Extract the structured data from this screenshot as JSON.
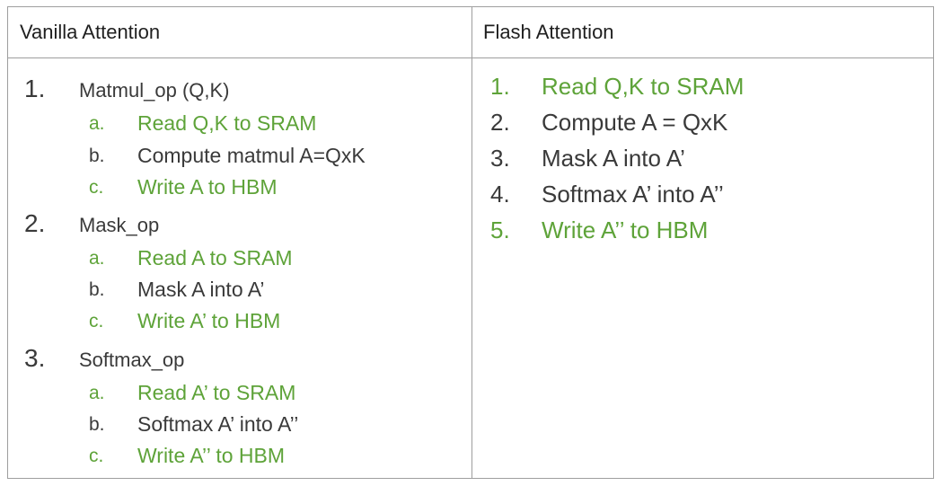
{
  "table": {
    "headers": {
      "left": "Vanilla Attention",
      "right": "Flash Attention"
    },
    "vanilla": [
      {
        "number": "1.",
        "label": "Matmul_op (Q,K)",
        "steps": [
          {
            "letter": "a.",
            "text": "Read Q,K to SRAM",
            "color": "#5ea339"
          },
          {
            "letter": "b.",
            "text": "Compute matmul A=QxK",
            "color": "#3a3a3a"
          },
          {
            "letter": "c.",
            "text": "Write A to HBM",
            "color": "#5ea339"
          }
        ]
      },
      {
        "number": "2.",
        "label": "Mask_op",
        "steps": [
          {
            "letter": "a.",
            "text": "Read A to SRAM",
            "color": "#5ea339"
          },
          {
            "letter": "b.",
            "text": "Mask A into A’",
            "color": "#3a3a3a"
          },
          {
            "letter": "c.",
            "text": "Write A’ to HBM",
            "color": "#5ea339"
          }
        ]
      },
      {
        "number": "3.",
        "label": "Softmax_op",
        "steps": [
          {
            "letter": "a.",
            "text": "Read A’ to SRAM",
            "color": "#5ea339"
          },
          {
            "letter": "b.",
            "text": "Softmax A’ into A’’",
            "color": "#3a3a3a"
          },
          {
            "letter": "c.",
            "text": "Write A’’ to HBM",
            "color": "#5ea339"
          }
        ]
      }
    ],
    "flash": [
      {
        "number": "1.",
        "text": "Read Q,K to SRAM",
        "color": "#5ea339"
      },
      {
        "number": "2.",
        "text": "Compute A = QxK",
        "color": "#3a3a3a"
      },
      {
        "number": "3.",
        "text": "Mask A into A’",
        "color": "#3a3a3a"
      },
      {
        "number": "4.",
        "text": "Softmax A’ into A’’",
        "color": "#3a3a3a"
      },
      {
        "number": "5.",
        "text": "Write A’’ to HBM",
        "color": "#5ea339"
      }
    ]
  }
}
